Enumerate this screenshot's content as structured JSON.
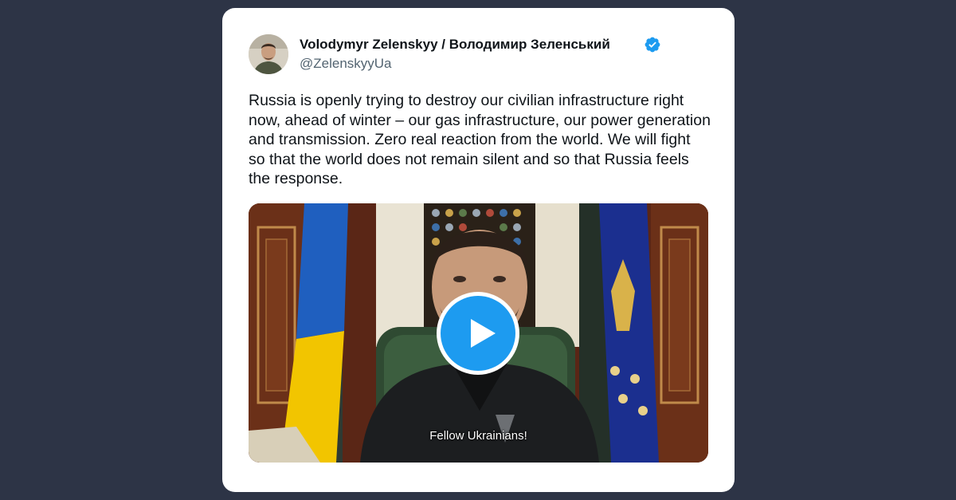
{
  "tweet": {
    "author": {
      "display_name": "Volodymyr Zelenskyy / Володимир Зеленський",
      "handle": "@ZelenskyyUa",
      "verified": true,
      "avatar_icon": "avatar-photo"
    },
    "text": "Russia is openly trying to destroy our civilian infrastructure right now, ahead of winter – our gas infrastructure, our power generation and transmission. Zero real reaction from the world. We will fight so that the world does not remain silent and so that Russia feels the response.",
    "media": {
      "type": "video",
      "caption": "Fellow Ukrainians!",
      "play_icon": "play-icon"
    }
  },
  "colors": {
    "page_background": "#2d3446",
    "card_background": "#ffffff",
    "accent_blue": "#1d9bf0",
    "text_primary": "#0f1419",
    "text_secondary": "#536471"
  }
}
